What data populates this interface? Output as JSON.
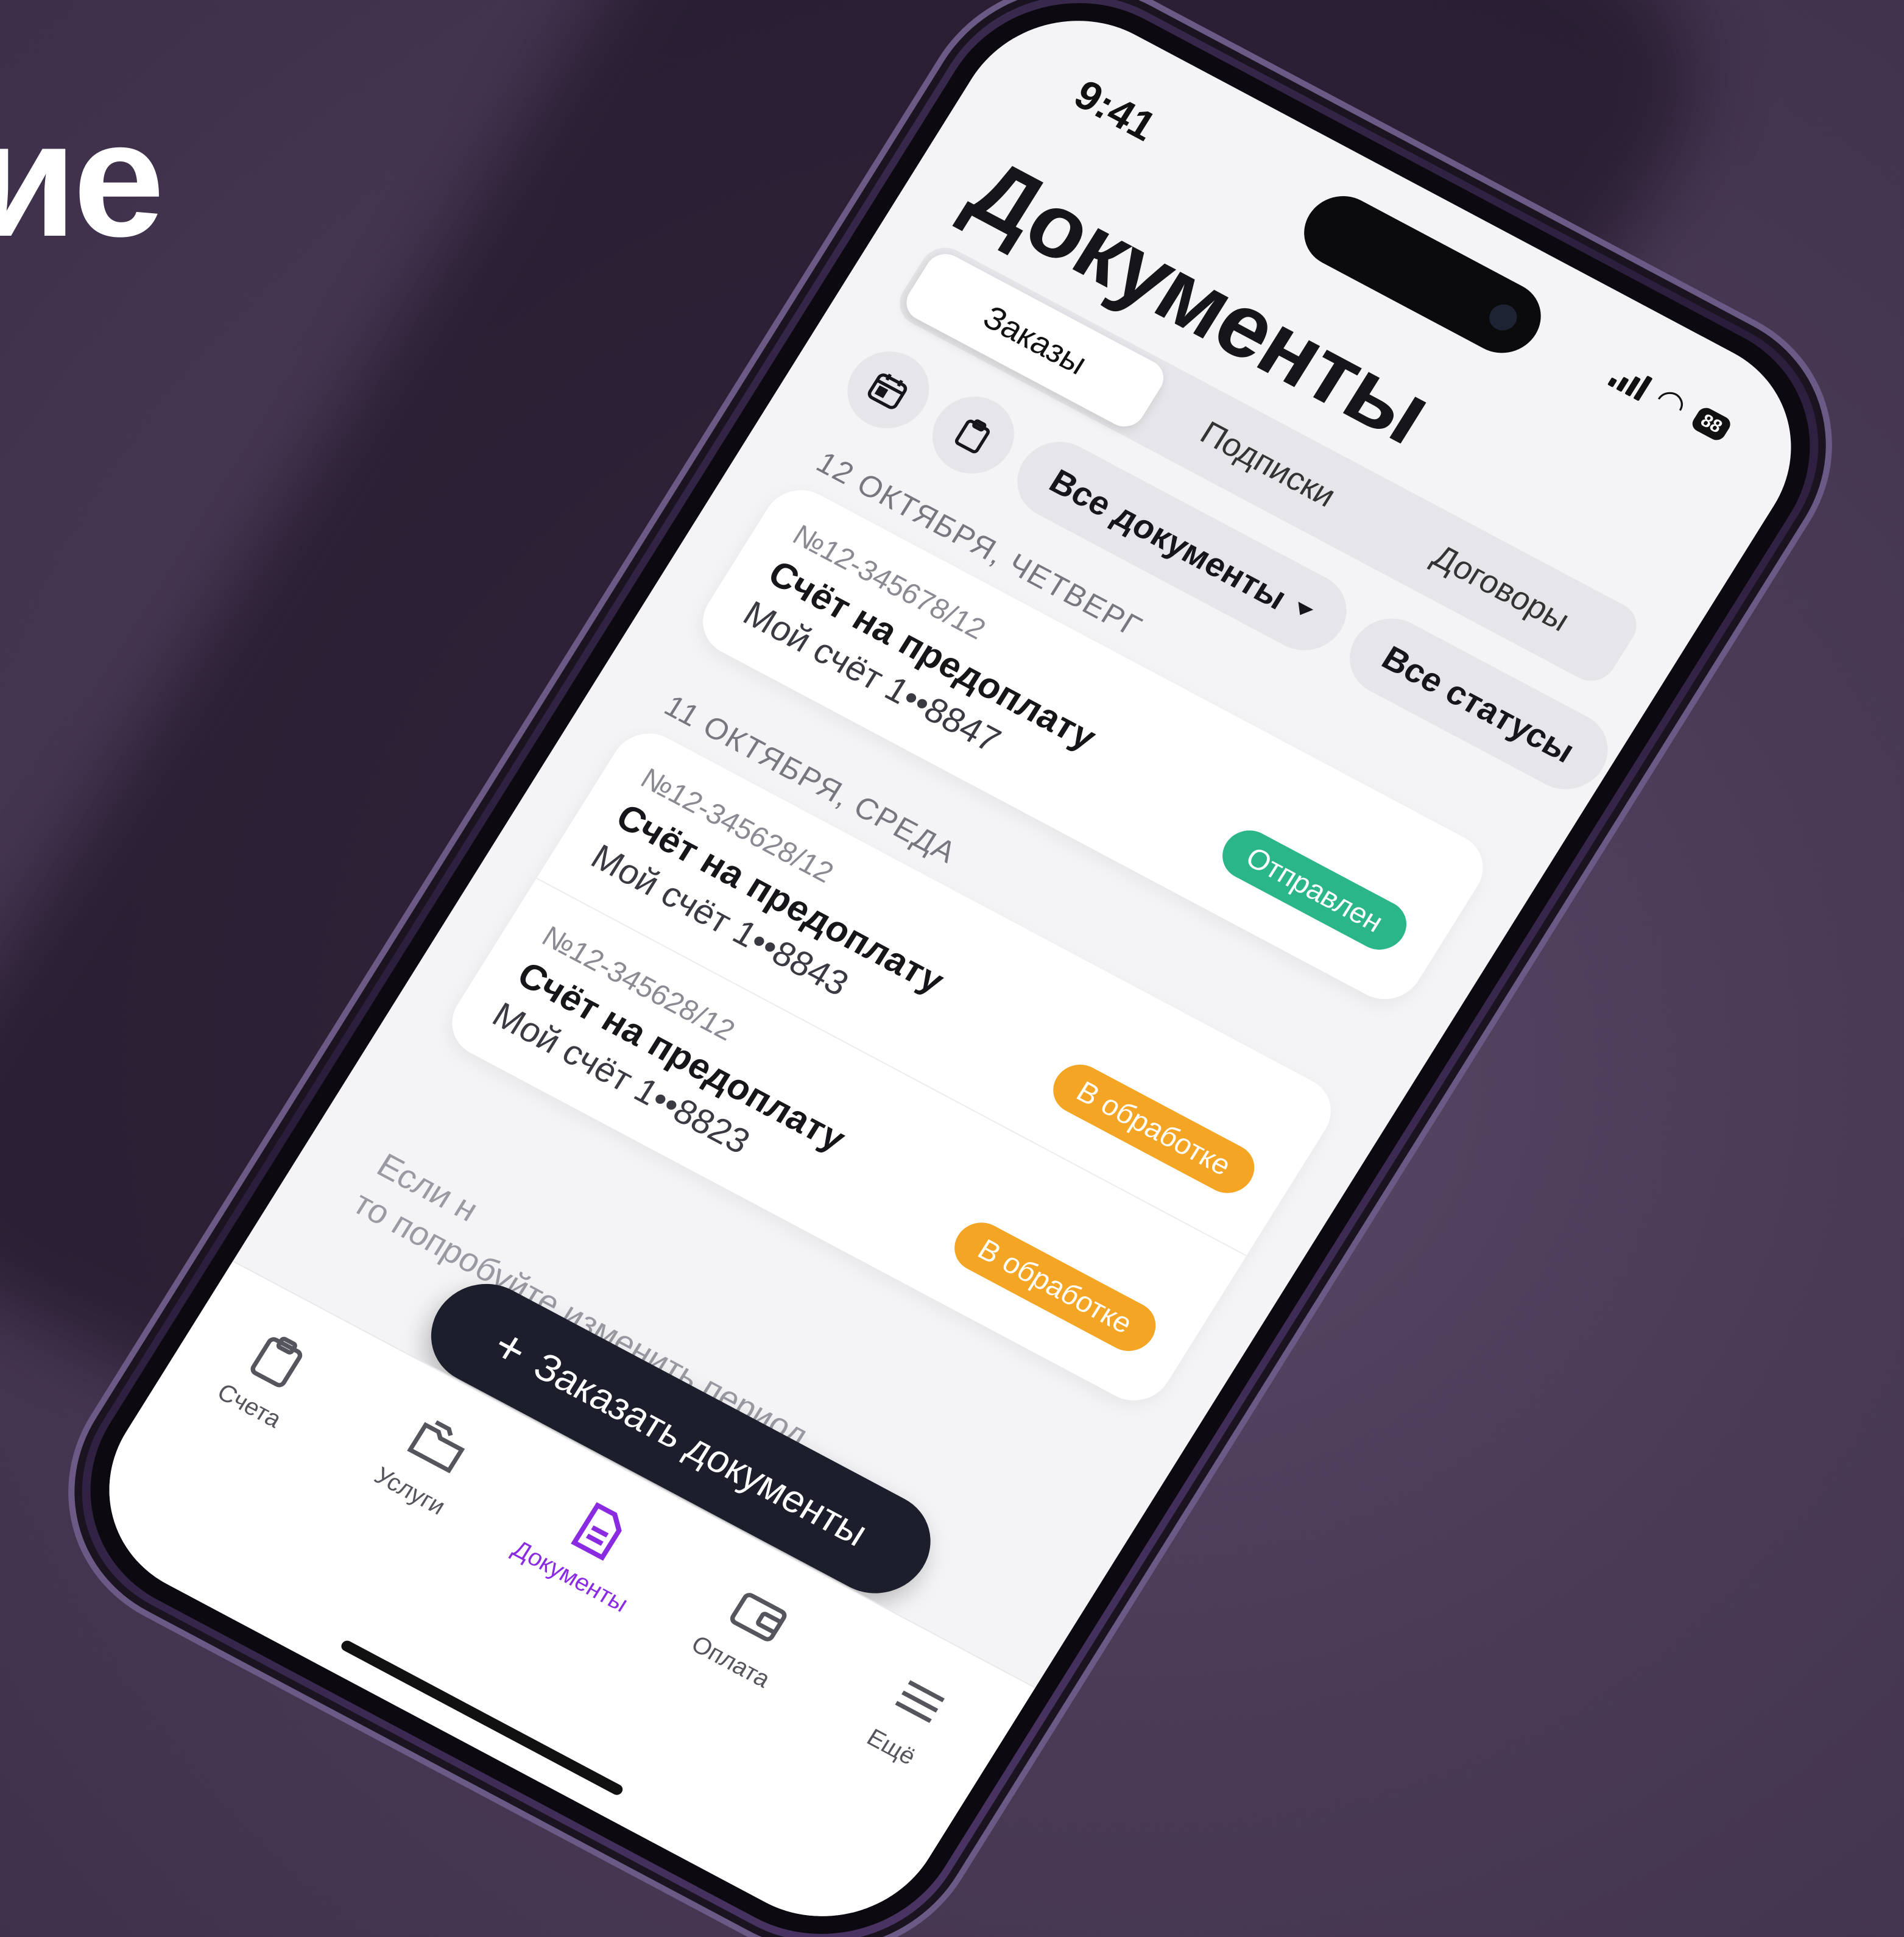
{
  "background": {
    "headline_fragment": "ие",
    "color": "#4a3a56"
  },
  "status_bar": {
    "time": "9:41",
    "battery": "88"
  },
  "header": {
    "title": "Документы"
  },
  "segments": [
    {
      "label": "Заказы",
      "active": true
    },
    {
      "label": "Подписки",
      "active": false
    },
    {
      "label": "Договоры",
      "active": false
    }
  ],
  "filters": {
    "calendar_icon": "calendar-icon",
    "clipboard_icon": "clipboard-icon",
    "documents_chip": "Все документы",
    "status_chip": "Все статусы"
  },
  "groups": [
    {
      "date": "12 ОКТЯБРЯ, ЧЕТВЕРГ",
      "documents": [
        {
          "number": "№12-345678/12",
          "title": "Счёт на предоплату",
          "account": "Мой счёт 1••8847",
          "status": "Отправлен",
          "status_color": "#2bb68a"
        }
      ]
    },
    {
      "date": "11 ОКТЯБРЯ, СРЕДА",
      "documents": [
        {
          "number": "№12-345628/12",
          "title": "Счёт на предоплату",
          "account": "Мой счёт 1••8843",
          "status": "В обработке",
          "status_color": "#f5a524"
        },
        {
          "number": "№12-345628/12",
          "title": "Счёт на предоплату",
          "account": "Мой счёт 1••8823",
          "status": "В обработке",
          "status_color": "#f5a524"
        }
      ]
    }
  ],
  "hint": {
    "line1": "Если н",
    "line2": "то попробуйте изменить период"
  },
  "fab": {
    "label": "Заказать документы"
  },
  "tabbar": [
    {
      "label": "Счета",
      "icon": "clipboard-icon",
      "active": false
    },
    {
      "label": "Услуги",
      "icon": "folder-icon",
      "active": false
    },
    {
      "label": "Документы",
      "icon": "document-icon",
      "active": true
    },
    {
      "label": "Оплата",
      "icon": "wallet-icon",
      "active": false
    },
    {
      "label": "Ещё",
      "icon": "menu-icon",
      "active": false
    }
  ],
  "accent_color": "#8a2be2"
}
